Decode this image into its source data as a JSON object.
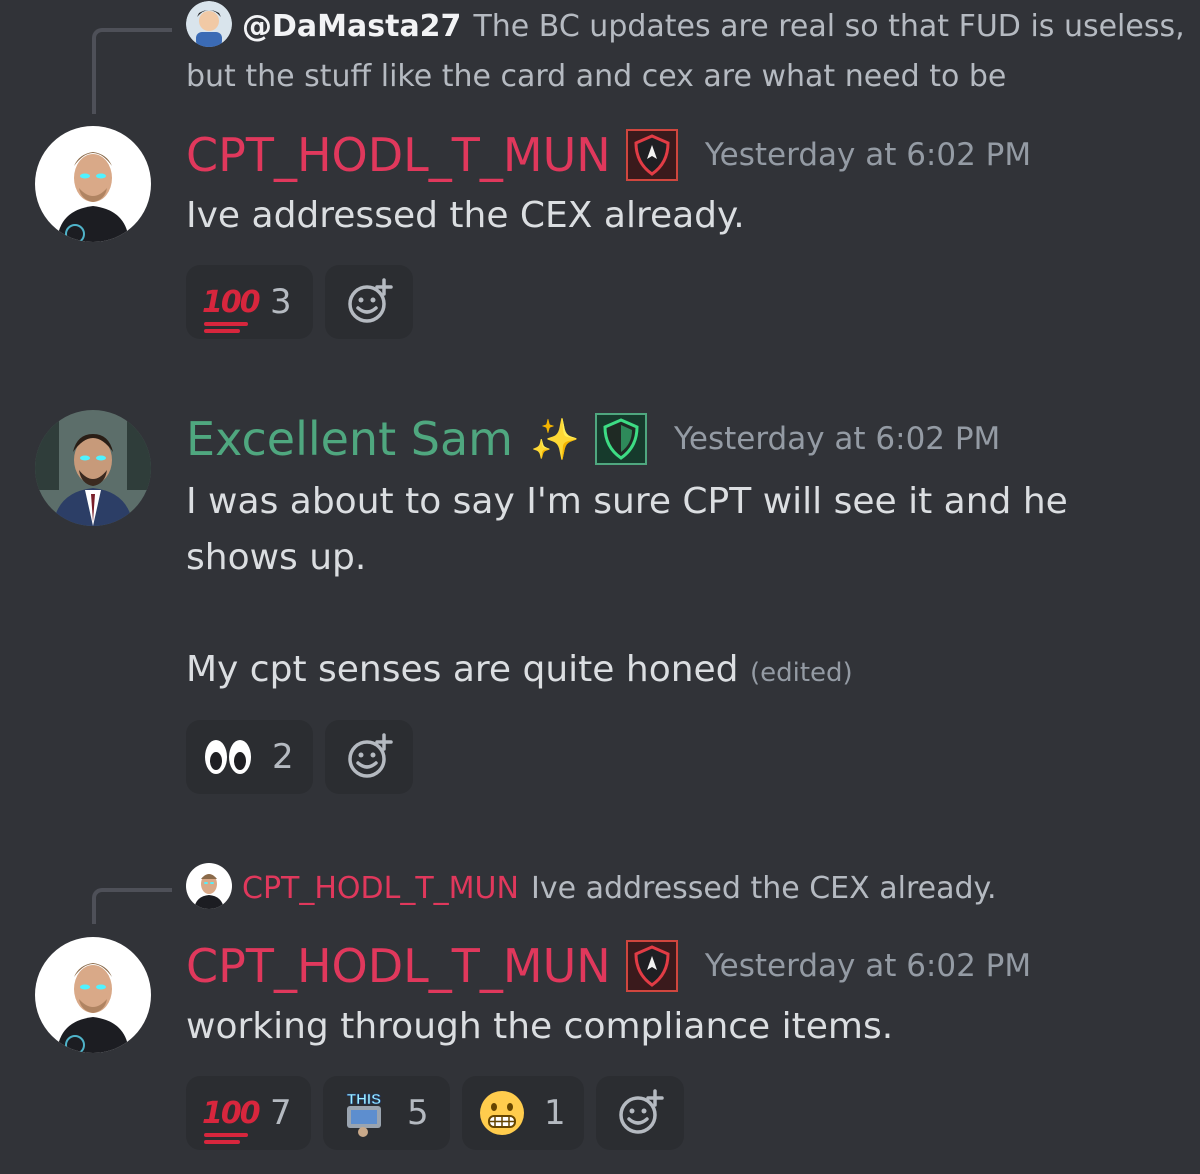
{
  "messages": [
    {
      "reply": {
        "username": "@DaMasta27",
        "text": "The BC updates are real so that FUD is useless, but the stuff like the card and cex are what need to be"
      },
      "author": {
        "name": "CPT_HODL_T_MUN",
        "color": "#e0385c"
      },
      "timestamp": "Yesterday at 6:02 PM",
      "body": "Ive addressed the CEX already.",
      "reactions": [
        {
          "emoji": "100-icon",
          "count": "3"
        }
      ]
    },
    {
      "author": {
        "name": "Excellent Sam",
        "color": "#4fa77f",
        "badge": "✨"
      },
      "timestamp": "Yesterday at 6:02 PM",
      "body_line1": "I was about to say I'm sure CPT will see it and he shows up.",
      "body_line2": "My cpt senses are quite honed",
      "edited": "(edited)",
      "reactions": [
        {
          "emoji": "eyes-icon",
          "count": "2"
        }
      ]
    },
    {
      "reply": {
        "username": "CPT_HODL_T_MUN",
        "text": "Ive addressed the CEX already."
      },
      "author": {
        "name": "CPT_HODL_T_MUN",
        "color": "#e0385c"
      },
      "timestamp": "Yesterday at 6:02 PM",
      "body": "working through the compliance items.",
      "reactions": [
        {
          "emoji": "100-icon",
          "count": "7"
        },
        {
          "emoji": "this-sticker-icon",
          "label": "THIS",
          "count": "5"
        },
        {
          "emoji": "grimacing-face-icon",
          "count": "1"
        }
      ]
    }
  ]
}
